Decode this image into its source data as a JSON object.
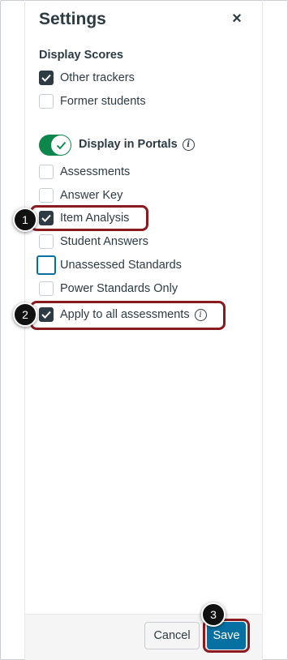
{
  "settings": {
    "title": "Settings",
    "close_label": "×",
    "display_scores": {
      "heading": "Display Scores",
      "options": [
        {
          "label": "Other trackers",
          "checked": true
        },
        {
          "label": "Former students",
          "checked": false
        }
      ]
    },
    "portals": {
      "toggle_label": "Display in Portals",
      "toggle_on": true,
      "info_glyph": "i",
      "options": [
        {
          "label": "Assessments",
          "checked": false
        },
        {
          "label": "Answer Key",
          "checked": false
        },
        {
          "label": "Item Analysis",
          "checked": true
        },
        {
          "label": "Student Answers",
          "checked": false
        },
        {
          "label": "Unassessed Standards",
          "checked": false
        },
        {
          "label": "Power Standards Only",
          "checked": false
        },
        {
          "label": "Apply to all assessments",
          "checked": true
        }
      ]
    },
    "footer": {
      "cancel_label": "Cancel",
      "save_label": "Save"
    }
  },
  "callouts": {
    "badge_1": "1",
    "badge_2": "2",
    "badge_3": "3"
  },
  "colors": {
    "accent": "#0770a3",
    "toggle_on": "#0b874b",
    "callout_border": "#8b1a1f",
    "text": "#2d3b45"
  }
}
